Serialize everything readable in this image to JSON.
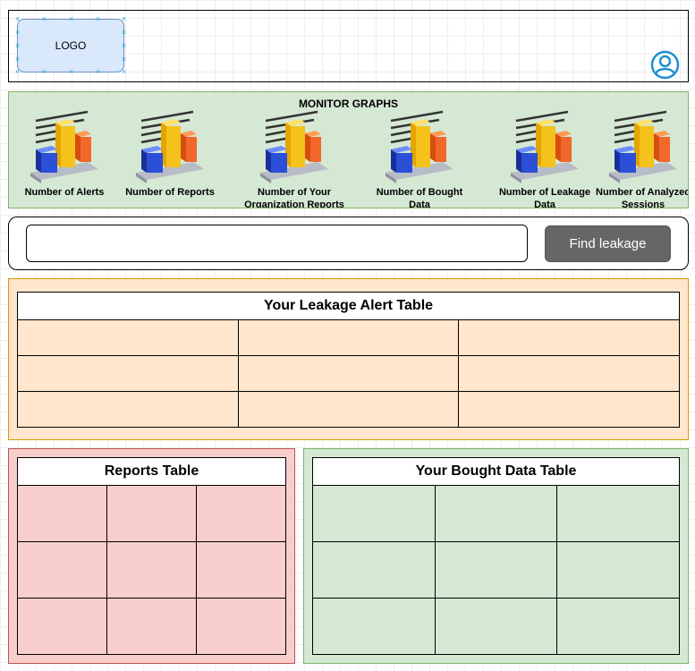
{
  "header": {
    "logo_text": "LOGO",
    "user_icon": "user-circle-icon"
  },
  "monitor": {
    "title": "MONITOR GRAPHS",
    "graphs": [
      {
        "label": "Number of Alerts",
        "icon": "bar-chart-icon"
      },
      {
        "label": "Number of Reports",
        "icon": "bar-chart-icon"
      },
      {
        "label": "Number of Your Organization Reports",
        "icon": "bar-chart-icon"
      },
      {
        "label": "Number of Bought Data",
        "icon": "bar-chart-icon"
      },
      {
        "label": "Number of Leakage Data",
        "icon": "bar-chart-icon"
      },
      {
        "label": "Number of Analyzed Sessions",
        "icon": "bar-chart-icon"
      }
    ]
  },
  "search": {
    "value": "",
    "placeholder": "",
    "button_label": "Find leakage"
  },
  "tables": {
    "leakage": {
      "title": "Your Leakage Alert Table"
    },
    "reports": {
      "title": "Reports Table"
    },
    "bought": {
      "title": "Your Bought Data Table"
    }
  },
  "colors": {
    "logo_fill": "#dae8fc",
    "graphs_fill": "#d5e8d4",
    "leakage_fill": "#ffe6cc",
    "reports_fill": "#f8cecc",
    "bought_fill": "#d5e8d4",
    "button_fill": "#666666",
    "user_icon": "#1f8fd0"
  }
}
